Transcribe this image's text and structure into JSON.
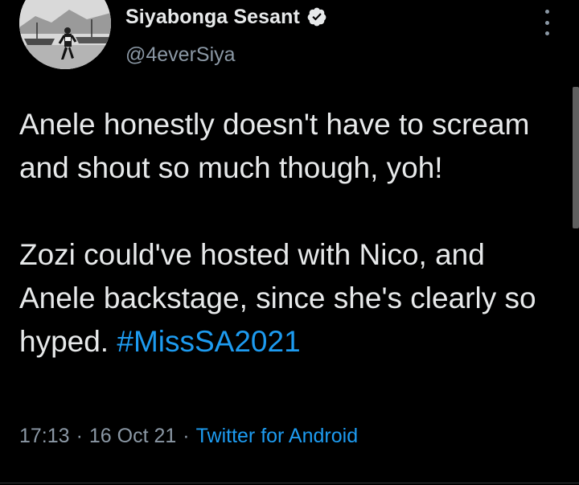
{
  "author": {
    "display_name": "Siyabonga Sesant",
    "handle": "@4everSiya",
    "verified": true,
    "avatar_icon": "profile-photo-runner-harbour"
  },
  "menu_icon": "more-vertical-icon",
  "tweet": {
    "paragraph1": "Anele honestly doesn't have to scream and shout so much though, yoh!",
    "paragraph2_text": "Zozi could've hosted with Nico, and Anele backstage, since she's clearly so hyped.",
    "hashtag": "#MissSA2021"
  },
  "meta": {
    "time": "17:13",
    "date": "16 Oct 21",
    "separator": "·",
    "source": "Twitter for Android"
  },
  "colors": {
    "background": "#000000",
    "text": "#e7e9ea",
    "secondary": "#8b98a5",
    "accent": "#1d9bf0"
  }
}
